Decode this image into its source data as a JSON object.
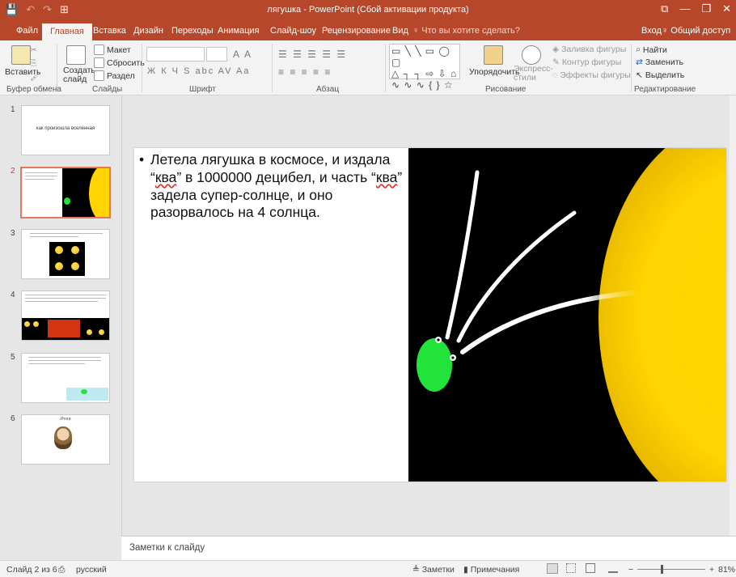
{
  "titlebar": {
    "title": "лягушка - PowerPoint (Сбой активации продукта)",
    "qat": [
      "💾",
      "↶",
      "↷",
      "⊞"
    ],
    "winbtns": [
      "⧉",
      "—",
      "❐",
      "✕"
    ]
  },
  "tabs": [
    {
      "label": "Файл",
      "active": false
    },
    {
      "label": "Главная",
      "active": true
    },
    {
      "label": "Вставка",
      "active": false
    },
    {
      "label": "Дизайн",
      "active": false
    },
    {
      "label": "Переходы",
      "active": false
    },
    {
      "label": "Анимация",
      "active": false
    },
    {
      "label": "Слайд-шоу",
      "active": false
    },
    {
      "label": "Рецензирование",
      "active": false
    },
    {
      "label": "Вид",
      "active": false
    }
  ],
  "tellme": "♀ Что вы хотите сделать?",
  "signin": "Вход",
  "share": "♀ Общий доступ",
  "ribbon": {
    "paste": "Вставить",
    "new_slide": "Создать слайд",
    "new_slide_arrow": "▾",
    "layout": "Макет",
    "reset": "Сбросить",
    "section": "Раздел",
    "font_format_glyphs": "Ж К Ч S abc AV Aa",
    "font_size_glyphs": "A A",
    "para_glyphs_1": "☰ ☰ ☰ ☰ ☰",
    "para_glyphs_2": "≡ ≡ ≡ ≡ ≡",
    "shapes_row1": "▭ ╲ ╲ ▭ ◯ ▢",
    "shapes_row2": "△ ┐ ┐ ⇨ ⇩ ⌂",
    "shapes_row3": "∿ ∿ ∿ { } ☆",
    "arrange": "Упорядочить",
    "quick_styles": "Экспресс-стили",
    "shape_fill": "Заливка фигуры",
    "shape_outline": "Контур фигуры",
    "shape_effects": "Эффекты фигуры",
    "find": "Найти",
    "replace": "Заменить",
    "select": "Выделить"
  },
  "groups": {
    "clipboard": "Буфер обмена",
    "slides": "Слайды",
    "font": "Шрифт",
    "paragraph": "Абзац",
    "drawing": "Рисование",
    "editing": "Редактирование"
  },
  "thumbnails": {
    "numbers": [
      "1",
      "2",
      "3",
      "4",
      "5",
      "6"
    ],
    "slide1_text": "как произошла вселенная",
    "slide6_title": "Итоги"
  },
  "slide": {
    "bullet": "•",
    "line1": "Летела лягушка в космосе, и издала “",
    "kva1": "ква",
    "line2": "” в 1000000 децибел, и часть “",
    "kva2": "ква",
    "line3": "” задела супер-солнце, и оно разорвалось на 4 солнца."
  },
  "notes_placeholder": "Заметки к слайду",
  "status": {
    "slide_info": "Слайд 2 из 6",
    "lang_icon": "⎙",
    "language": "русский",
    "notes_btn": "≜ Заметки",
    "comments_btn": "▮ Примечания",
    "minus": "−",
    "plus": "+",
    "zoom": "81%"
  },
  "colors": {
    "accent": "#b7472a",
    "frog": "#22e33a",
    "sun": "#ffd700"
  }
}
